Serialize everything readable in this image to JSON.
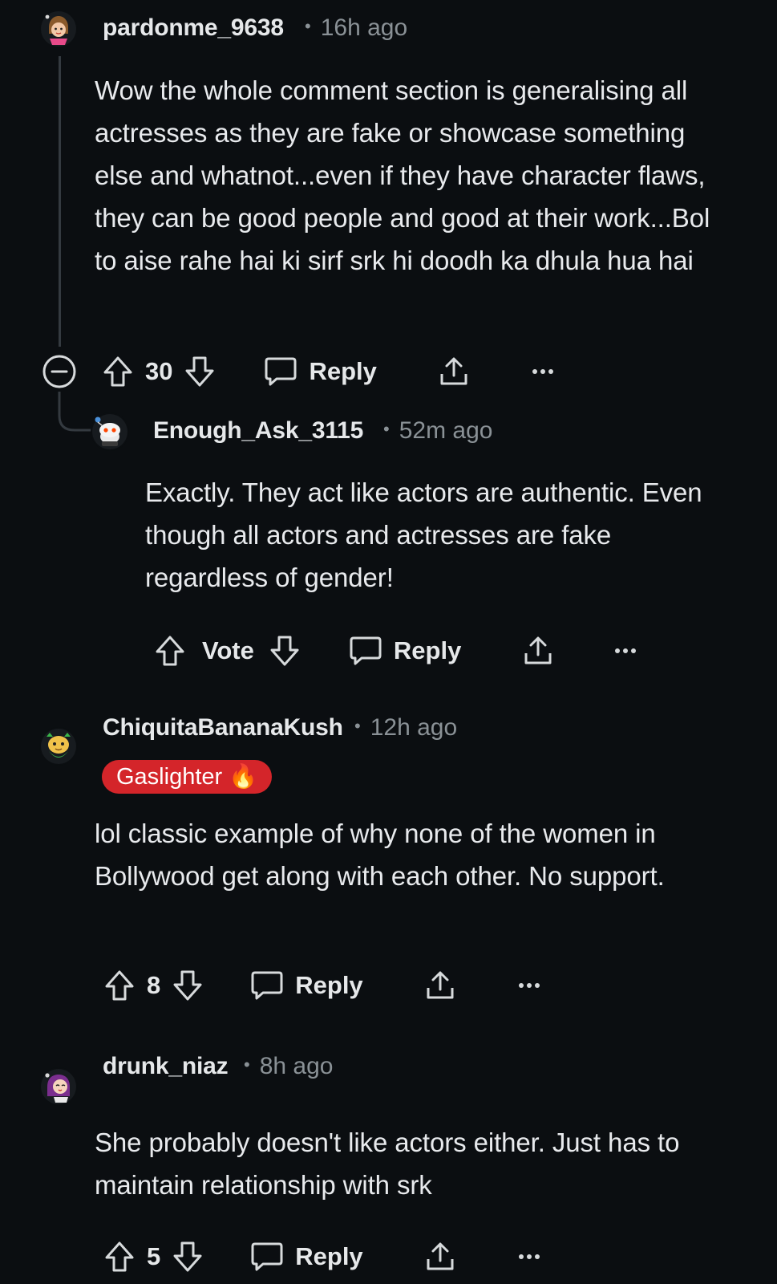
{
  "comments": [
    {
      "username": "pardonme_9638",
      "time": "16h ago",
      "body": "Wow the whole comment section is generalising all actresses as they are fake or showcase something else and whatnot...even if they have character flaws, they can be good people and good at their work...Bol to aise rahe hai ki sirf srk hi doodh ka dhula hua hai",
      "score": "30",
      "reply_label": "Reply",
      "more_label": "•••",
      "avatar_icon": "avatar-icon"
    },
    {
      "username": "Enough_Ask_3115",
      "time": "52m ago",
      "body": "Exactly. They act like actors are authentic. Even though all actors and actresses are fake regardless of gender!",
      "score": "Vote",
      "reply_label": "Reply",
      "more_label": "•••",
      "avatar_icon": "avatar-icon"
    },
    {
      "username": "ChiquitaBananaKush",
      "time": "12h ago",
      "flair": "Gaslighter 🔥",
      "body": "lol classic example of why none of the women in Bollywood get along with each other. No support.",
      "score": "8",
      "reply_label": "Reply",
      "more_label": "•••",
      "avatar_icon": "avatar-icon"
    },
    {
      "username": "drunk_niaz",
      "time": "8h ago",
      "body": "She probably doesn't like actors either. Just has to maintain relationship with srk",
      "score": "5",
      "reply_label": "Reply",
      "more_label": "•••",
      "avatar_icon": "avatar-icon"
    }
  ],
  "separator": "•",
  "colors": {
    "background": "#0b0e11",
    "text": "#e8eaed",
    "muted": "#8a9196",
    "flair": "#d4252a",
    "thread_line": "#343a40"
  },
  "icons": [
    "collapse-icon",
    "upvote-icon",
    "downvote-icon",
    "comment-icon",
    "share-icon",
    "more-icon"
  ]
}
